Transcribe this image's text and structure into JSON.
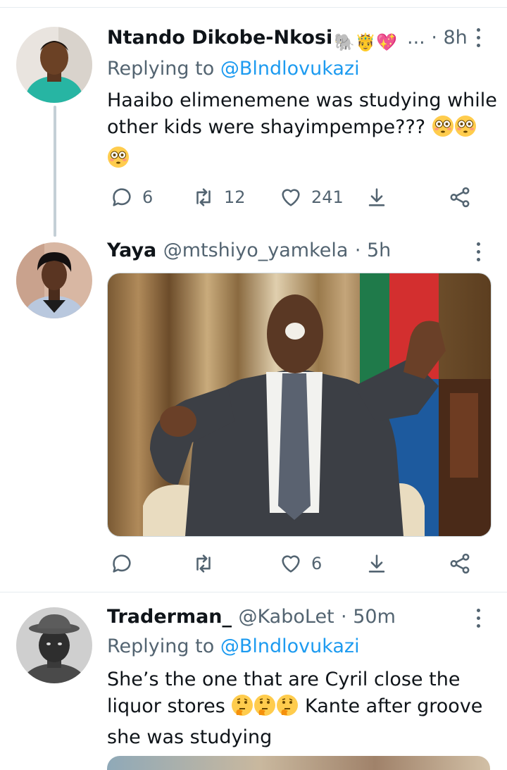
{
  "tweets": [
    {
      "name": "Ntando Dikobe-Nkosi",
      "name_emojis": "🐘🤴💖",
      "ellipsis": "...",
      "time": "· 8h",
      "replying_prefix": "Replying to",
      "replying_handle": "@Blndlovukazi",
      "text_line1": "Haaibo elimenemene was studying while",
      "text_line2": "other kids were shayimpempe???",
      "replies": "6",
      "retweets": "12",
      "likes": "241"
    },
    {
      "name": "Yaya",
      "handle": "@mtshiyo_yamkela",
      "time": "· 5h",
      "likes": "6",
      "image_alt": "Man in a dark suit laughing with arms raised, seated in a chair in front of curtains and a flag"
    },
    {
      "name": "Traderman_",
      "handle": "@KaboLet",
      "time": "· 50m",
      "replying_prefix": "Replying to",
      "replying_handle": "@Blndlovukazi",
      "text_line1": "She’s the one that are Cyril close the",
      "text_line2_a": "liquor stores",
      "text_line2_b": "Kante after groove",
      "text_line3": "she was studying"
    }
  ],
  "icons": [
    "reply-icon",
    "retweet-icon",
    "like-icon",
    "share-icon",
    "more-icon"
  ],
  "colors": {
    "link": "#1d9bf0",
    "secondary": "#536471",
    "primary_text": "#0f1419"
  }
}
